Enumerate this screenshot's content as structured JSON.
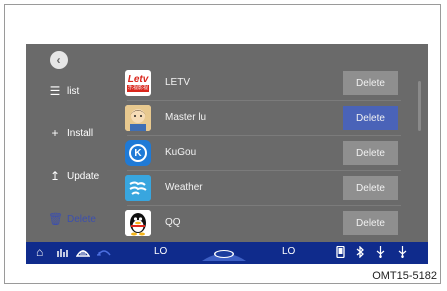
{
  "sidebar": {
    "list_label": "list",
    "install_label": "Install",
    "update_label": "Update",
    "delete_label": "Delete"
  },
  "apps": [
    {
      "name": "LETV",
      "button": "Delete",
      "icon": "letv-icon"
    },
    {
      "name": "Master lu",
      "button": "Delete",
      "icon": "master-lu-icon"
    },
    {
      "name": "KuGou",
      "button": "Delete",
      "icon": "kugou-icon"
    },
    {
      "name": "Weather",
      "button": "Delete",
      "icon": "weather-icon"
    },
    {
      "name": "QQ",
      "button": "Delete",
      "icon": "qq-icon"
    }
  ],
  "letv_logo_text": "Letv",
  "letv_logo_sub": "乐视影视",
  "kugou_letter": "K",
  "status_bar": {
    "left_temp": "LO",
    "right_temp": "LO"
  },
  "caption": "OMT15-5182",
  "colors": {
    "screen_bg": "#6a6a6a",
    "status_bar": "#0f2b8c",
    "active_button": "#4a63b8",
    "button": "#8f8f8f"
  }
}
